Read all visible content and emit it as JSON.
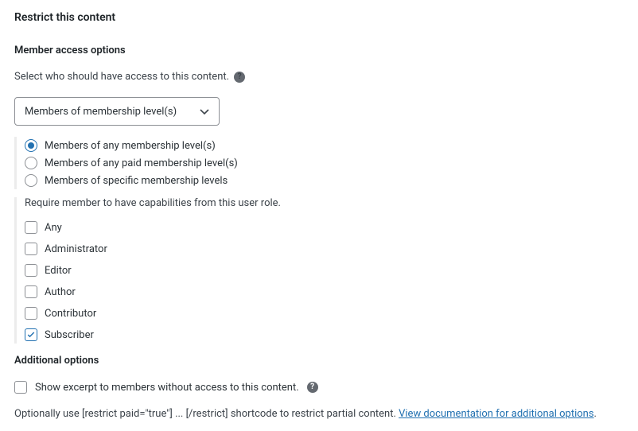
{
  "panel": {
    "title": "Restrict this content"
  },
  "member_access": {
    "label": "Member access options",
    "help_text": "Select who should have access to this content.",
    "select_value": "Members of membership level(s)",
    "radios": [
      {
        "label": "Members of any membership level(s)",
        "selected": true
      },
      {
        "label": "Members of any paid membership level(s)",
        "selected": false
      },
      {
        "label": "Members of specific membership levels",
        "selected": false
      }
    ],
    "roles": {
      "heading": "Require member to have capabilities from this user role.",
      "items": [
        {
          "label": "Any",
          "checked": false
        },
        {
          "label": "Administrator",
          "checked": false
        },
        {
          "label": "Editor",
          "checked": false
        },
        {
          "label": "Author",
          "checked": false
        },
        {
          "label": "Contributor",
          "checked": false
        },
        {
          "label": "Subscriber",
          "checked": true
        }
      ]
    }
  },
  "additional": {
    "label": "Additional options",
    "excerpt_label": "Show excerpt to members without access to this content.",
    "excerpt_checked": false,
    "note_prefix": "Optionally use [restrict paid=\"true\"] ... [/restrict] shortcode to restrict partial content. ",
    "note_link": "View documentation for additional options",
    "note_suffix": "."
  }
}
